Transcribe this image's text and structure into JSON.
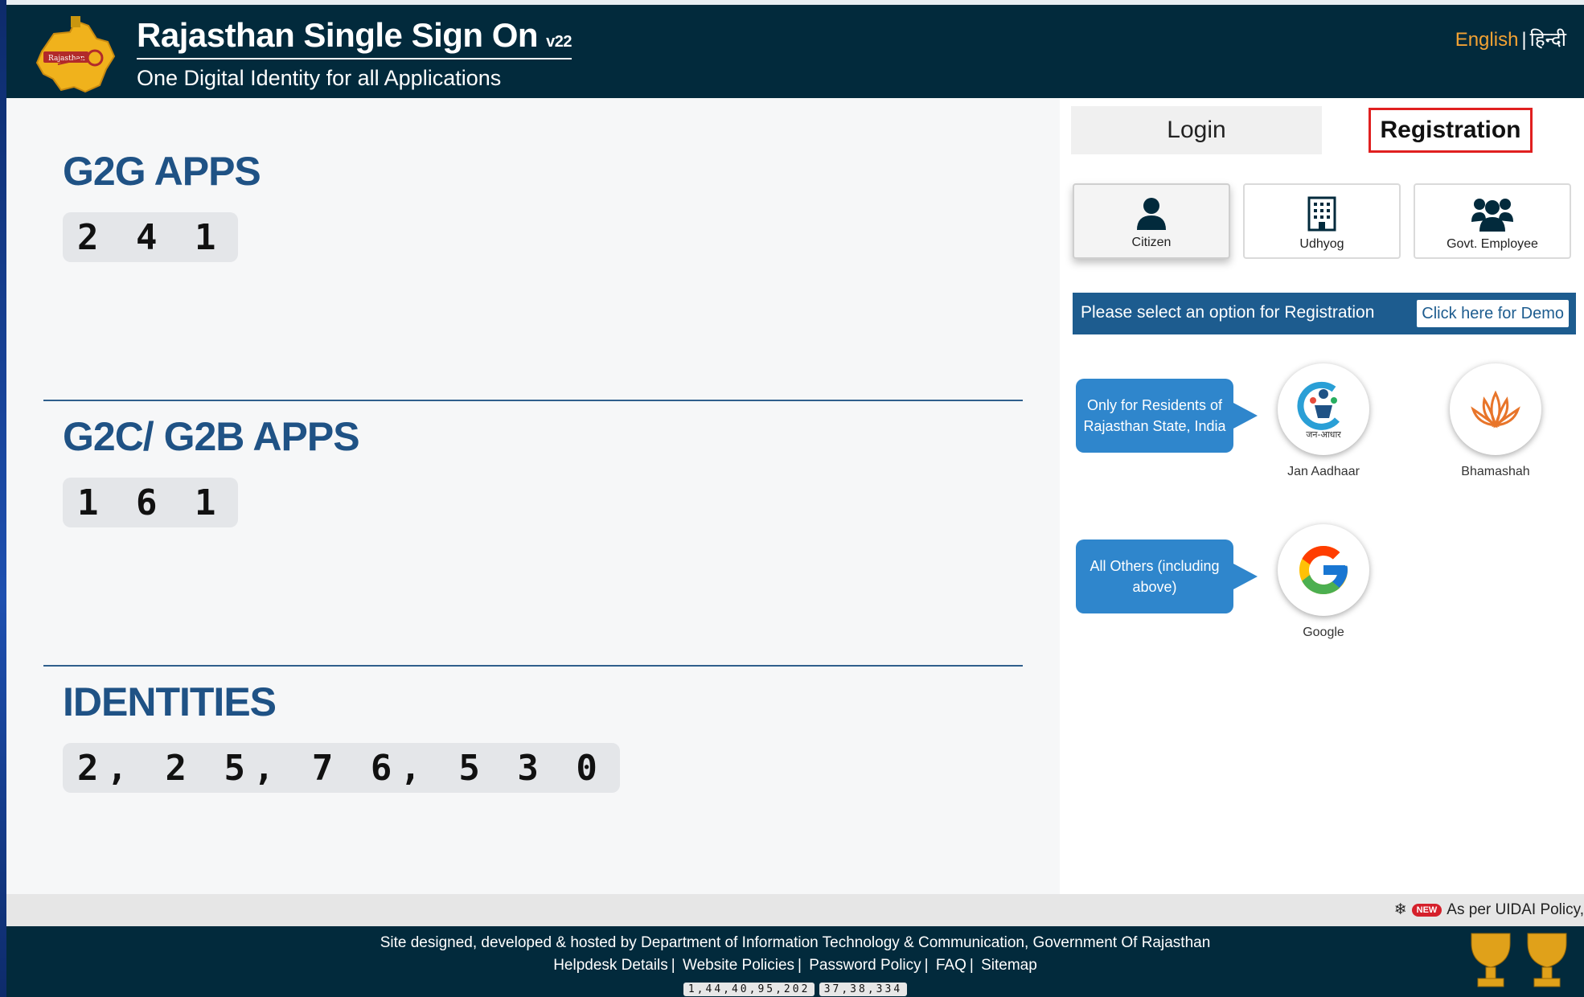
{
  "header": {
    "title": "Rajasthan Single Sign On",
    "version": "v22",
    "subtitle": "One Digital Identity for all Applications",
    "lang_english": "English",
    "lang_separator": "|",
    "lang_hindi": "हिन्दी"
  },
  "stats": [
    {
      "title": "G2G APPS",
      "value": "2 4 1"
    },
    {
      "title": "G2C/ G2B APPS",
      "value": "1 6 1"
    },
    {
      "title": "IDENTITIES",
      "value": "2, 2 5, 7 6, 5 3 0"
    }
  ],
  "tabs": {
    "login": "Login",
    "registration": "Registration"
  },
  "user_types": [
    {
      "label": "Citizen",
      "icon": "person-icon",
      "active": true
    },
    {
      "label": "Udhyog",
      "icon": "building-icon",
      "active": false
    },
    {
      "label": "Govt. Employee",
      "icon": "group-icon",
      "active": false
    }
  ],
  "info_bar": {
    "text": "Please select an option for Registration",
    "demo": "Click here for Demo"
  },
  "options": {
    "residents_note": "Only for Residents of Rajasthan State, India",
    "jan_aadhaar": "Jan Aadhaar",
    "jan_aadhaar_logo_text": "जन-आधार",
    "bhamashah": "Bhamashah",
    "others_note": "All Others (including above)",
    "google": "Google"
  },
  "ticker": {
    "new_badge": "NEW",
    "text": "As per UIDAI Policy,"
  },
  "footer": {
    "designed_by": "Site designed, developed & hosted by Department of Information Technology & Communication, Government Of Rajasthan",
    "links": [
      "Helpdesk Details",
      "Website Policies",
      "Password Policy",
      "FAQ",
      "Sitemap"
    ],
    "visitor_count": "1,44,40,95,202",
    "today_count": "37,38,334"
  },
  "colors": {
    "header_bg": "#022a3c",
    "accent_orange": "#f3a233",
    "stat_title": "#1f5285",
    "info_bar": "#1d5c8f",
    "bubble": "#2f86cc"
  }
}
